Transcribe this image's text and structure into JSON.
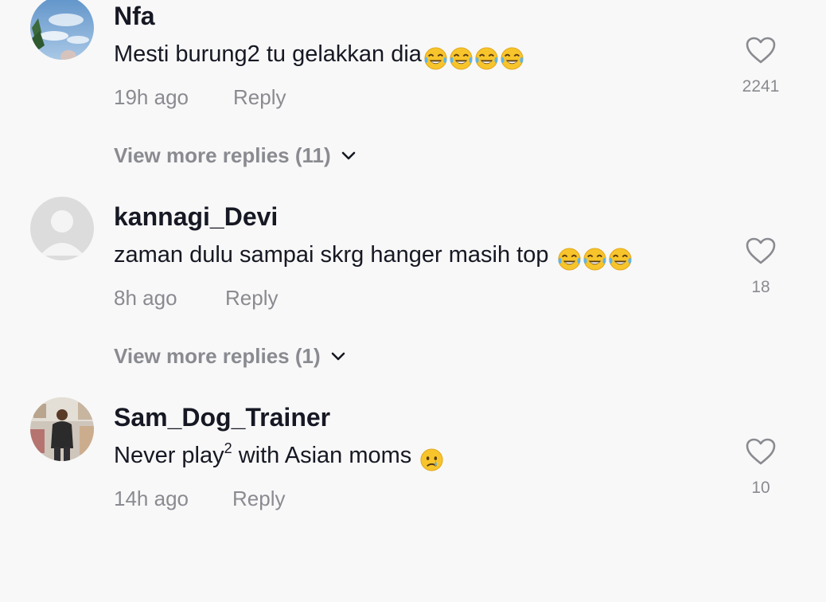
{
  "comments": [
    {
      "username": "Nfa",
      "text": "Mesti burung2 tu gelakkan dia",
      "emojis": [
        "face-with-tears-of-joy",
        "face-with-tears-of-joy",
        "face-with-tears-of-joy",
        "face-with-tears-of-joy"
      ],
      "time": "19h ago",
      "reply_label": "Reply",
      "likes": "2241",
      "view_more": "View more replies (11)"
    },
    {
      "username": "kannagi_Devi",
      "text": "zaman dulu sampai skrg hanger masih top",
      "emojis": [
        "face-with-tears-of-joy",
        "face-with-tears-of-joy",
        "face-with-tears-of-joy"
      ],
      "time": "8h ago",
      "reply_label": "Reply",
      "likes": "18",
      "view_more": "View more replies (1)"
    },
    {
      "username": "Sam_Dog_Trainer",
      "text_before": "Never play",
      "text_sup": "2",
      "text_after": " with Asian moms",
      "emojis": [
        "crying-face"
      ],
      "time": "14h ago",
      "reply_label": "Reply",
      "likes": "10"
    }
  ],
  "colors": {
    "background": "#f8f8f8",
    "primary_text": "#161823",
    "secondary_text": "#8a8b91",
    "heart_outline": "#8a8b91"
  },
  "icons": {
    "like": "heart-outline-icon",
    "expand": "chevron-down-icon"
  }
}
